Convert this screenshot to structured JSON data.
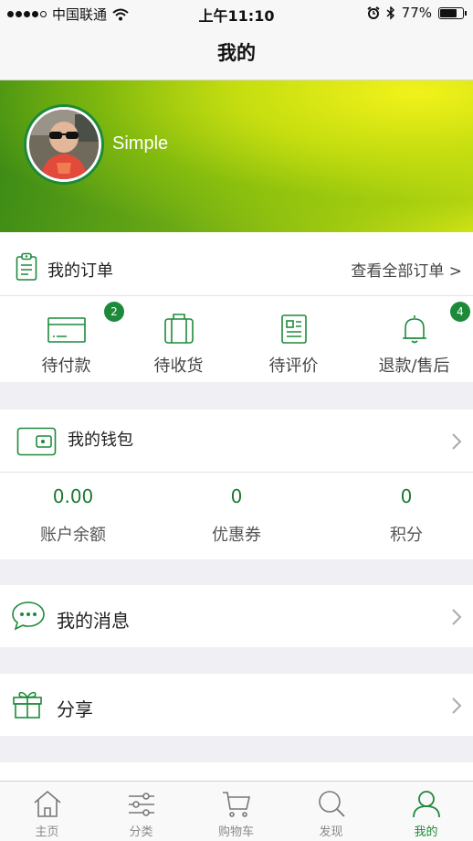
{
  "status_bar": {
    "carrier": "中国联通",
    "time": "上午11:10",
    "battery": "77%",
    "battery_level": 0.77
  },
  "nav": {
    "title": "我的"
  },
  "profile": {
    "username": "Simple"
  },
  "orders": {
    "title": "我的订单",
    "view_all": "查看全部订单 >",
    "items": [
      {
        "label": "待付款",
        "badge": "2",
        "icon": "card-icon"
      },
      {
        "label": "待收货",
        "badge": "",
        "icon": "box-icon"
      },
      {
        "label": "待评价",
        "badge": "",
        "icon": "review-icon"
      },
      {
        "label": "退款/售后",
        "badge": "4",
        "icon": "bell-icon"
      }
    ]
  },
  "wallet": {
    "title": "我的钱包",
    "items": [
      {
        "value": "0.00",
        "label": "账户余额"
      },
      {
        "value": "0",
        "label": "优惠券"
      },
      {
        "value": "0",
        "label": "积分"
      }
    ]
  },
  "messages": {
    "title": "我的消息"
  },
  "share": {
    "title": "分享"
  },
  "tabbar": {
    "items": [
      {
        "label": "主页",
        "icon": "home-icon",
        "active": false
      },
      {
        "label": "分类",
        "icon": "sliders-icon",
        "active": false
      },
      {
        "label": "购物车",
        "icon": "cart-icon",
        "active": false
      },
      {
        "label": "发现",
        "icon": "search-icon",
        "active": false
      },
      {
        "label": "我的",
        "icon": "user-icon",
        "active": true
      }
    ]
  },
  "colors": {
    "accent": "#1d8a3a",
    "background": "#efeff4"
  }
}
